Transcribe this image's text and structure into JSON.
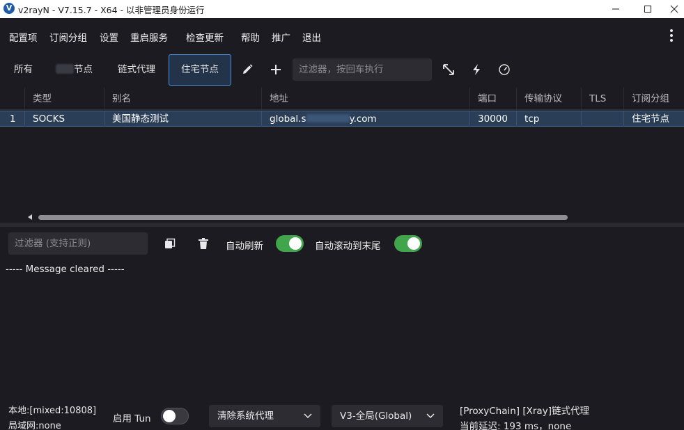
{
  "window": {
    "title": "v2rayN - V7.15.7 - X64 - 以非管理员身份运行",
    "app_icon_glyph": "V",
    "min_icon": "minimize-icon",
    "max_icon": "maximize-icon",
    "close_icon": "close-icon"
  },
  "menu": {
    "items": [
      "配置项",
      "订阅分组",
      "设置",
      "重启服务",
      "检查更新",
      "帮助",
      "推广",
      "退出"
    ],
    "more_icon": "more-vertical-icon"
  },
  "tabs": {
    "all": "所有",
    "nodes_suffix": "节点",
    "chain": "链式代理",
    "residential": "住宅节点",
    "active": "住宅节点"
  },
  "toolbar": {
    "filter_placeholder": "过滤器，按回车执行",
    "icons": [
      "edit-icon",
      "add-icon",
      "expand-icon",
      "lightning-icon",
      "speed-gauge-icon"
    ]
  },
  "table": {
    "headers": [
      "类型",
      "别名",
      "地址",
      "端口",
      "传输协议",
      "TLS",
      "订阅分组"
    ],
    "rows": [
      {
        "index": "1",
        "type": "SOCKS",
        "alias": "美国静态测试",
        "address_prefix": "global.s",
        "address_suffix": "y.com",
        "port": "30000",
        "transport": "tcp",
        "tls": "",
        "group": "住宅节点"
      }
    ]
  },
  "log": {
    "filter_placeholder": "过滤器 (支持正则)",
    "copy_icon": "copy-icon",
    "delete_icon": "trash-icon",
    "auto_refresh_label": "自动刷新",
    "auto_refresh_on": true,
    "auto_scroll_label": "自动滚动到末尾",
    "auto_scroll_on": true,
    "message": "----- Message cleared -----"
  },
  "status": {
    "local": "本地:[mixed:10808]",
    "lan": "局域网:none",
    "tun_label": "启用 Tun",
    "tun_on": false,
    "system_proxy": "清除系统代理",
    "routing": "V3-全局(Global)",
    "proxy_info": "[ProxyChain] [Xray]链式代理",
    "latency": "当前延迟: 193 ms，none"
  },
  "colors": {
    "background": "#1c1b22",
    "selected_row": "#2a3e58",
    "accent_border": "#4a90d9",
    "toggle_on": "#41a54b"
  }
}
